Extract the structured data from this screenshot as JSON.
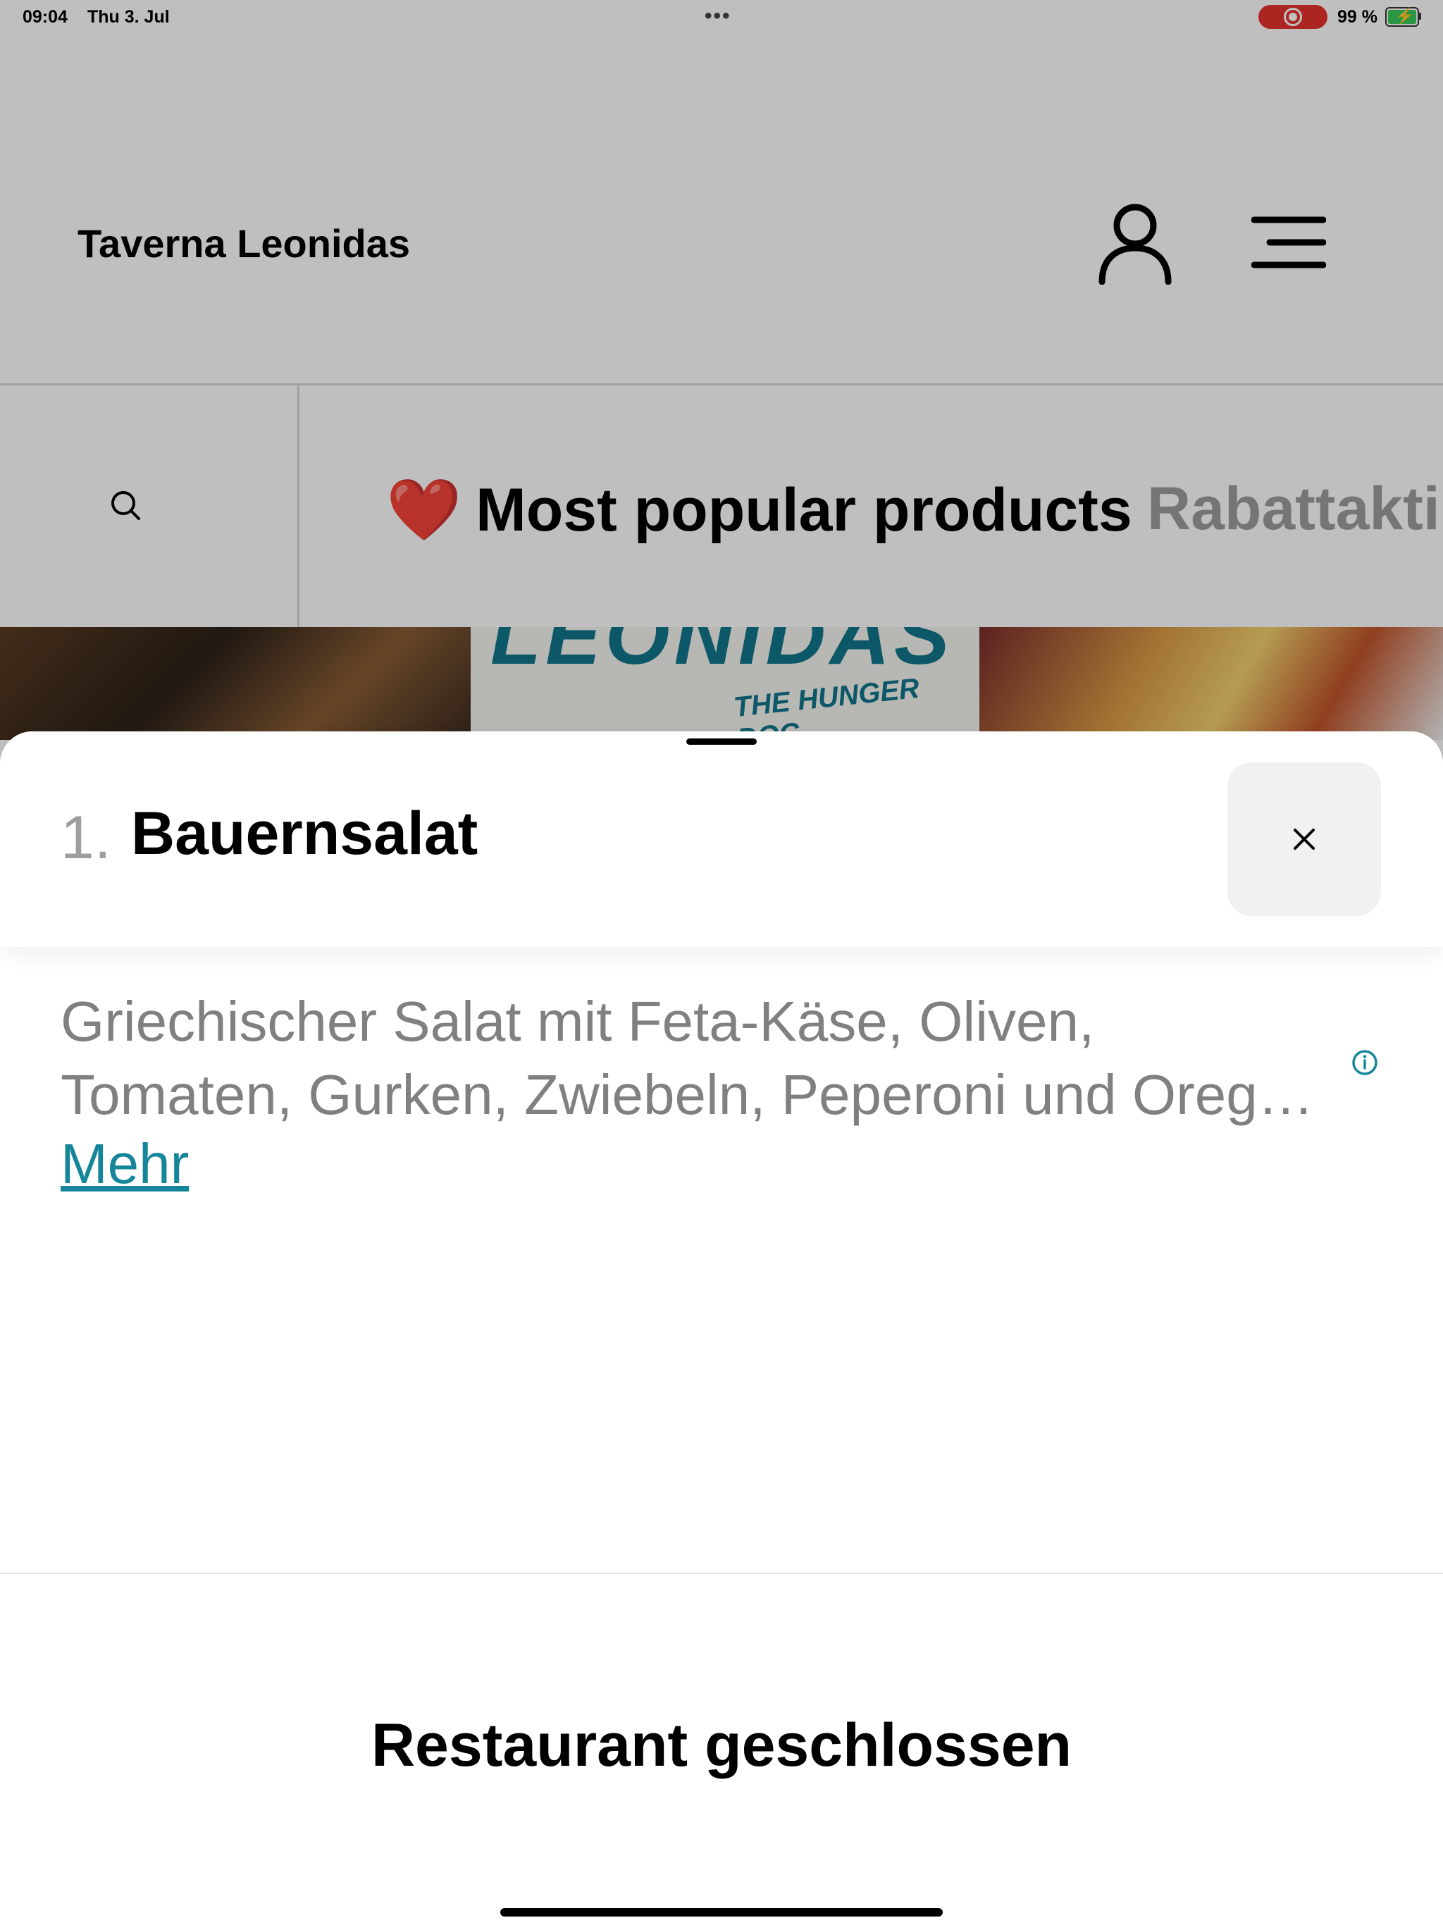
{
  "status_bar": {
    "time": "09:04",
    "date": "Thu 3. Jul",
    "battery_percent": "99 %",
    "multitasking_dots": "•••"
  },
  "header": {
    "brand": "Taverna Leonidas",
    "icons": [
      "user-icon",
      "menu-icon"
    ]
  },
  "categories": {
    "active": {
      "emoji": "❤️",
      "label": "Most popular products"
    },
    "next": {
      "label": "Rabattakti"
    }
  },
  "hero": {
    "logo_text": "LEONIDAS",
    "logo_subtext": "THE HUNGER DOC"
  },
  "product_sheet": {
    "number": "1.",
    "title": "Bauernsalat",
    "description_lines": [
      "Griechischer Salat mit Feta-Käse, Oliven,",
      "Tomaten, Gurken, Zwiebeln, Peperoni und Oreg…"
    ],
    "more_label": "Mehr",
    "status": "Restaurant geschlossen"
  },
  "colors": {
    "link": "#15869a",
    "record_indicator": "#e5322d",
    "battery_fill": "#38c759"
  }
}
